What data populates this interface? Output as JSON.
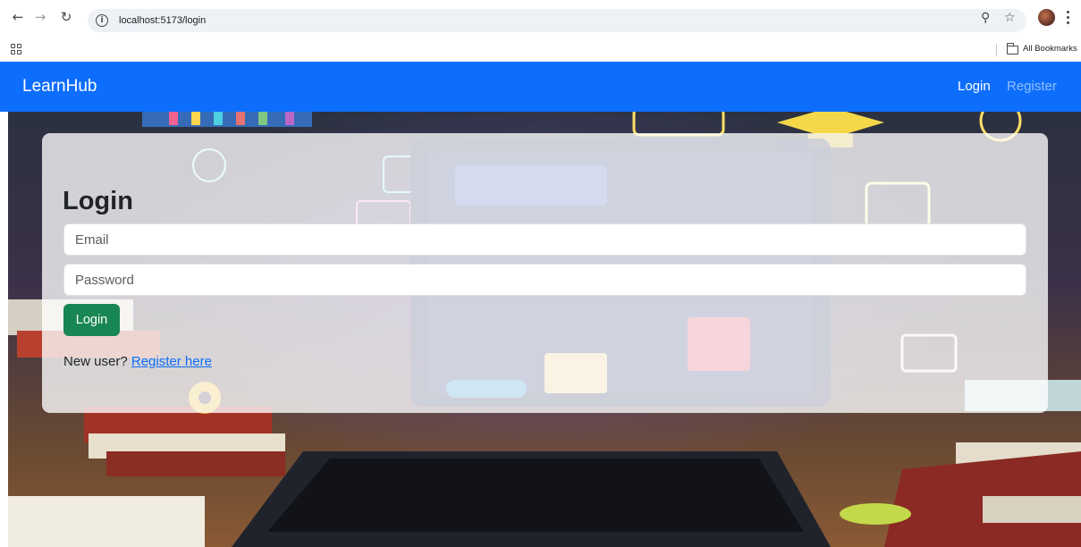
{
  "browser": {
    "url": "localhost:5173/login",
    "bookmarks_label": "All Bookmarks"
  },
  "navbar": {
    "brand": "LearnHub",
    "links": [
      {
        "label": "Login",
        "active": true
      },
      {
        "label": "Register",
        "active": false
      }
    ],
    "color": "#0d6efd"
  },
  "login_form": {
    "title": "Login",
    "email_placeholder": "Email",
    "password_placeholder": "Password",
    "submit_label": "Login",
    "submit_color": "#198754",
    "signup_prompt": "New user?",
    "signup_link": "Register here"
  },
  "icons": {
    "back": "back-arrow-icon",
    "forward": "forward-arrow-icon",
    "reload": "reload-icon",
    "site_info": "info-icon",
    "zoom": "zoom-icon",
    "bookmark": "star-icon",
    "apps": "apps-grid-icon",
    "folder": "folder-icon",
    "menu": "kebab-menu-icon"
  }
}
